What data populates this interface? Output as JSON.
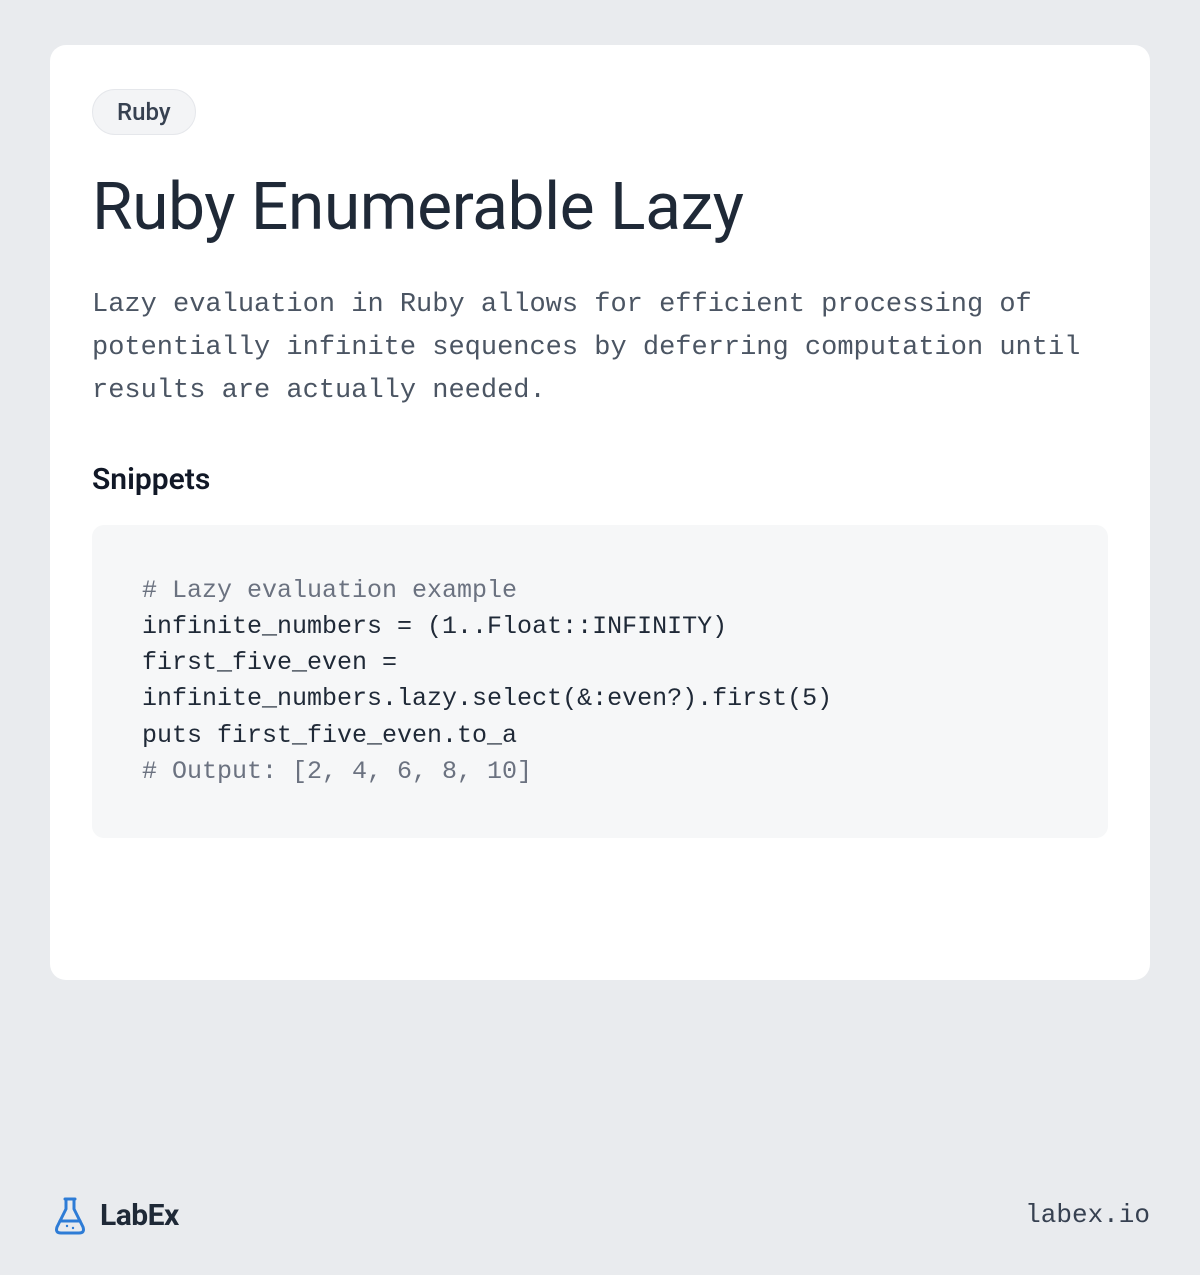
{
  "tag": "Ruby",
  "title": "Ruby Enumerable Lazy",
  "description": "Lazy evaluation in Ruby allows for efficient processing of potentially infinite sequences by deferring computation until results are actually needed.",
  "snippets_heading": "Snippets",
  "code": {
    "comment1": "# Lazy evaluation example",
    "line1": "infinite_numbers = (1..Float::INFINITY)",
    "line2": "first_five_even = infinite_numbers.lazy.select(&:even?).first(5)",
    "line3": "puts first_five_even.to_a",
    "comment2": "# Output: [2, 4, 6, 8, 10]"
  },
  "footer": {
    "brand": "LabEx",
    "url": "labex.io"
  }
}
